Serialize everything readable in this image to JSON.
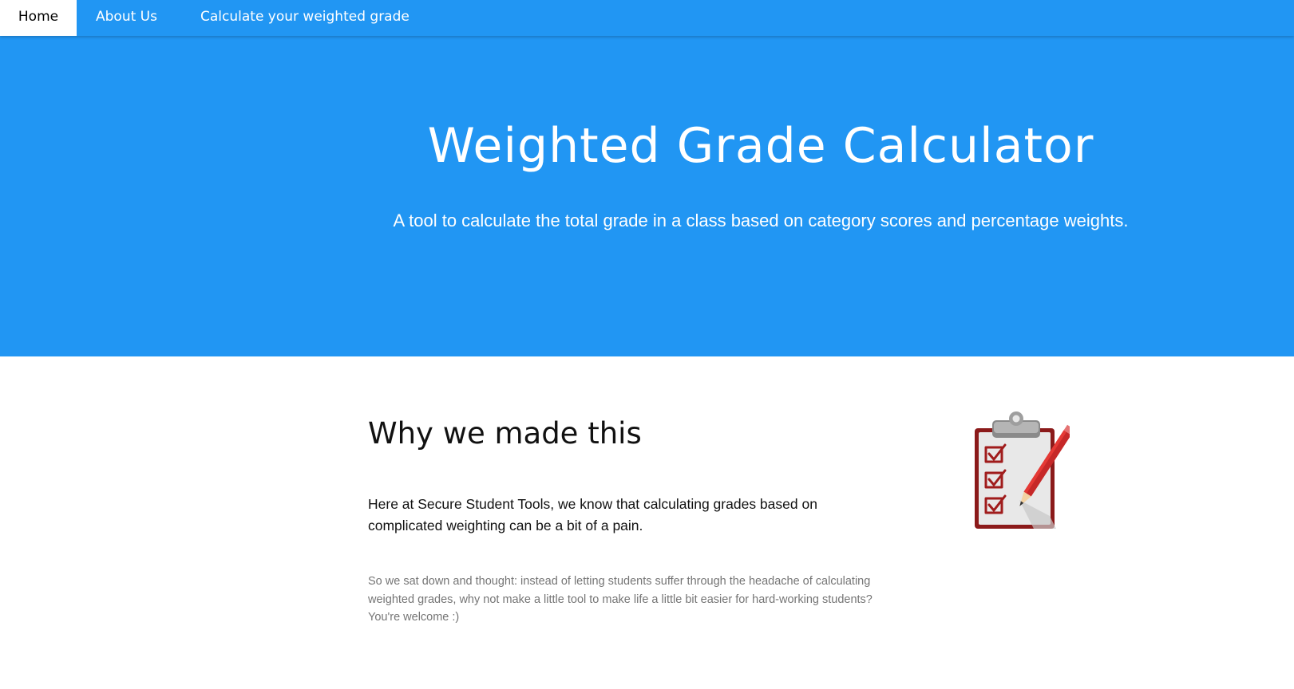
{
  "nav": {
    "items": [
      {
        "label": "Home",
        "active": true
      },
      {
        "label": "About Us",
        "active": false
      },
      {
        "label": "Calculate your weighted grade",
        "active": false
      }
    ]
  },
  "hero": {
    "title": "Weighted Grade Calculator",
    "subtitle": "A tool to calculate the total grade in a class based on category scores and percentage weights."
  },
  "about": {
    "heading": "Why we made this",
    "lead": "Here at Secure Student Tools, we know that calculating grades based on complicated weighting can be a bit of a pain.",
    "body": "So we sat down and thought: instead of letting students suffer through the headache of calculating weighted grades, why not make a little tool to make life a little bit easier for hard-working students? You're welcome :)",
    "image_icon": "clipboard-checklist-icon"
  },
  "colors": {
    "primary": "#2196f3",
    "text_dark": "#111111",
    "text_muted": "#757575",
    "clipboard_red": "#8b1a1a"
  }
}
